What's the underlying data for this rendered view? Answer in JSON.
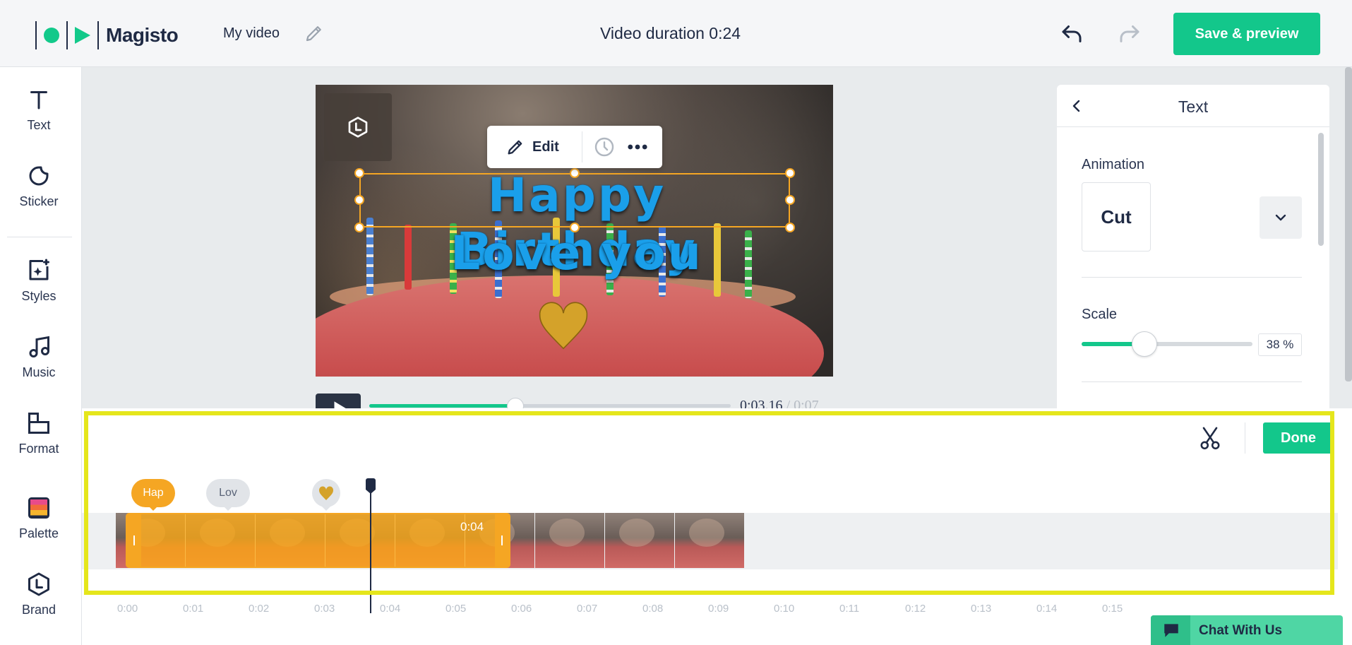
{
  "header": {
    "logo_text": "Magisto",
    "video_name": "My video",
    "duration": "Video duration 0:24",
    "save_label": "Save & preview"
  },
  "sidebar": {
    "items": [
      {
        "label": "Text",
        "icon": "text-icon"
      },
      {
        "label": "Sticker",
        "icon": "sticker-icon"
      },
      {
        "label": "Styles",
        "icon": "styles-icon"
      },
      {
        "label": "Music",
        "icon": "music-icon"
      },
      {
        "label": "Format",
        "icon": "format-icon"
      },
      {
        "label": "Palette",
        "icon": "palette-icon"
      },
      {
        "label": "Brand",
        "icon": "brand-icon"
      }
    ]
  },
  "preview": {
    "title_line1": "Happy Birthday",
    "title_line2": "Love you",
    "toolbar": {
      "edit_label": "Edit"
    },
    "player": {
      "current_time": "0:03.16",
      "total_time": "0:07",
      "progress": 0.41
    }
  },
  "panel": {
    "title": "Text",
    "animation_label": "Animation",
    "animation_value": "Cut",
    "scale_label": "Scale",
    "scale_value": "38",
    "scale_unit": "%",
    "scale_fraction": 0.38
  },
  "timeline": {
    "done_label": "Done",
    "pills": {
      "text1": "Hap",
      "text2": "Lov"
    },
    "clip_duration": "0:04",
    "ruler": [
      "0:00",
      "0:01",
      "0:02",
      "0:03",
      "0:04",
      "0:05",
      "0:06",
      "0:07",
      "0:08",
      "0:09",
      "0:10",
      "0:11",
      "0:12",
      "0:13",
      "0:14",
      "0:15"
    ]
  },
  "chat": {
    "label": "Chat With Us"
  },
  "colors": {
    "accent": "#13c78b",
    "selection": "#f5a623",
    "highlight": "#e5e61c",
    "title_text": "#1a9fea"
  }
}
